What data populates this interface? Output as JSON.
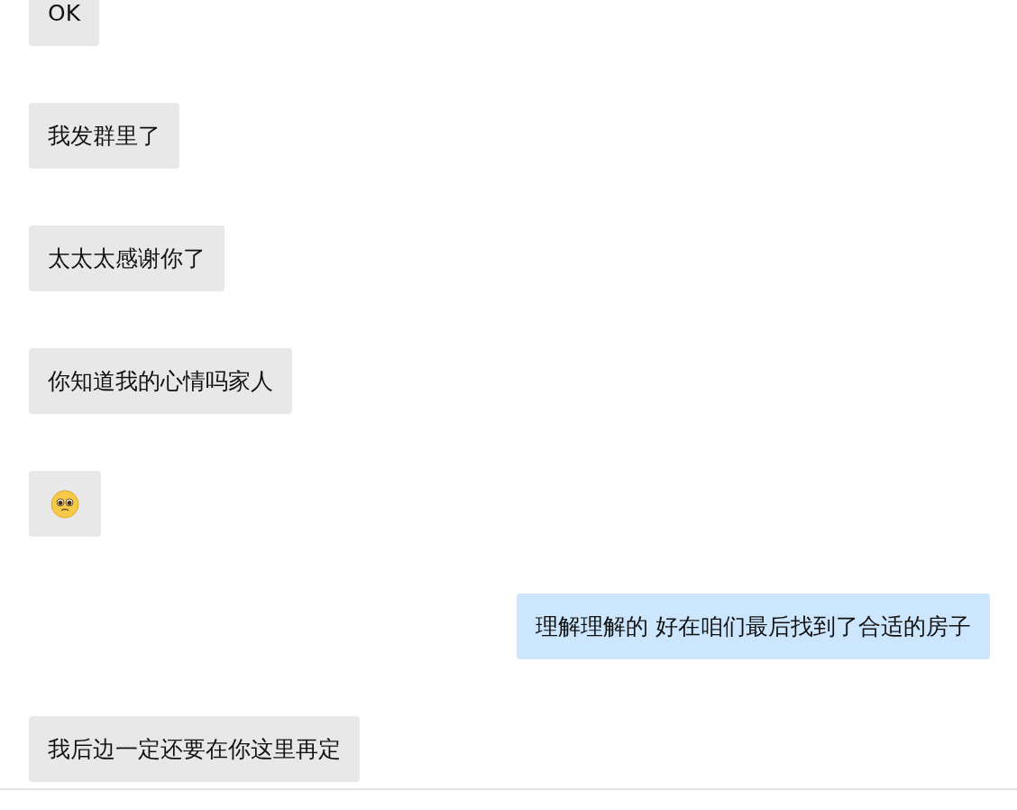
{
  "messages": [
    {
      "kind": "text",
      "outgoing": false,
      "text": "OK"
    },
    {
      "kind": "text",
      "outgoing": false,
      "text": "我发群里了"
    },
    {
      "kind": "text",
      "outgoing": false,
      "text": "太太太感谢你了"
    },
    {
      "kind": "text",
      "outgoing": false,
      "text": "你知道我的心情吗家人"
    },
    {
      "kind": "emoji",
      "outgoing": false
    },
    {
      "kind": "text",
      "outgoing": true,
      "text": "理解理解的 好在咱们最后找到了合适的房子"
    },
    {
      "kind": "text",
      "outgoing": false,
      "text": "我后边一定还要在你这里再定"
    }
  ]
}
